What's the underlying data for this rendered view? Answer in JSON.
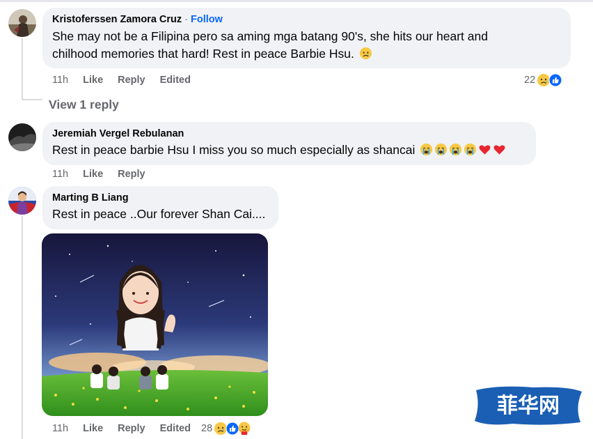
{
  "comments": [
    {
      "author": "Kristoferssen Zamora Cruz",
      "follow_label": "Follow",
      "separator": "·",
      "text_line1": "She may not be a Filipina pero sa aming mga batang 90's, she hits our heart and",
      "text_line2": "chilhood memories that hard! Rest in peace Barbie Hsu.",
      "time": "11h",
      "like_label": "Like",
      "reply_label": "Reply",
      "edited_label": "Edited",
      "reaction_count": "22",
      "reactions": [
        "sad-emoji",
        "like-emoji"
      ]
    },
    {
      "author": "Jeremiah Vergel Rebulanan",
      "text": "Rest in peace barbie Hsu I miss you so much especially as shancai",
      "inline_emojis": [
        "crying-emoji",
        "crying-emoji",
        "crying-emoji",
        "crying-emoji",
        "red-heart-emoji",
        "red-heart-emoji"
      ],
      "time": "11h",
      "like_label": "Like",
      "reply_label": "Reply"
    },
    {
      "author": "Marting B Liang",
      "text": "Rest in peace ..Our forever Shan Cai....",
      "time": "11h",
      "like_label": "Like",
      "reply_label": "Reply",
      "edited_label": "Edited",
      "reaction_count": "28",
      "reactions": [
        "sad-emoji",
        "like-emoji",
        "care-emoji"
      ]
    }
  ],
  "view_replies_label": "View 1 reply",
  "watermark": {
    "text": "菲华网",
    "color": "#1a5fb4"
  },
  "colors": {
    "bubble": "#f0f2f5",
    "secondary_text": "#65676b",
    "link_blue": "#0866ff",
    "like_blue": "#0866ff"
  }
}
